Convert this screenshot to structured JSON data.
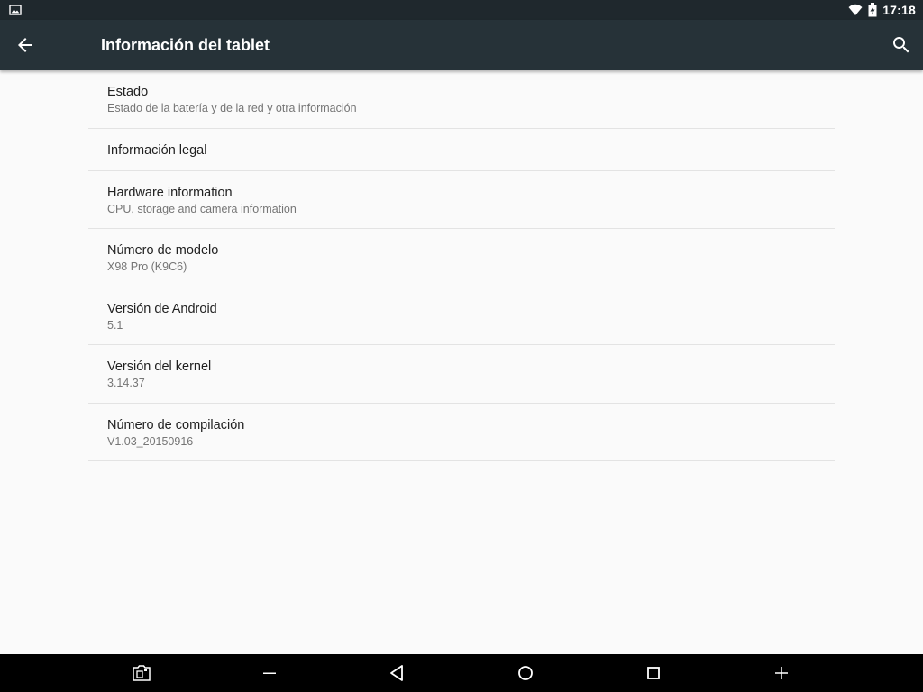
{
  "status_bar": {
    "time": "17:18",
    "icons": [
      "image-notification-icon",
      "wifi-icon",
      "battery-charging-icon"
    ]
  },
  "app_bar": {
    "title": "Información del tablet",
    "back_icon": "arrow-back-icon",
    "search_icon": "search-icon"
  },
  "items": [
    {
      "primary": "Estado",
      "secondary": "Estado de la batería y de la red y otra información"
    },
    {
      "primary": "Información legal"
    },
    {
      "primary": "Hardware information",
      "secondary": "CPU, storage and camera information"
    },
    {
      "primary": "Número de modelo",
      "secondary": "X98 Pro (K9C6)"
    },
    {
      "primary": "Versión de Android",
      "secondary": "5.1"
    },
    {
      "primary": "Versión del kernel",
      "secondary": "3.14.37"
    },
    {
      "primary": "Número de compilación",
      "secondary": "V1.03_20150916"
    }
  ],
  "nav_bar": {
    "buttons": [
      "screenshot-icon",
      "volume-down-icon",
      "back-icon",
      "home-icon",
      "recents-icon",
      "volume-up-icon"
    ]
  },
  "colors": {
    "status_bar": "#1f282d",
    "app_bar": "#263238",
    "background": "#fafafa",
    "primary_text": "#212121",
    "secondary_text": "#757575",
    "nav_bar": "#000000"
  }
}
